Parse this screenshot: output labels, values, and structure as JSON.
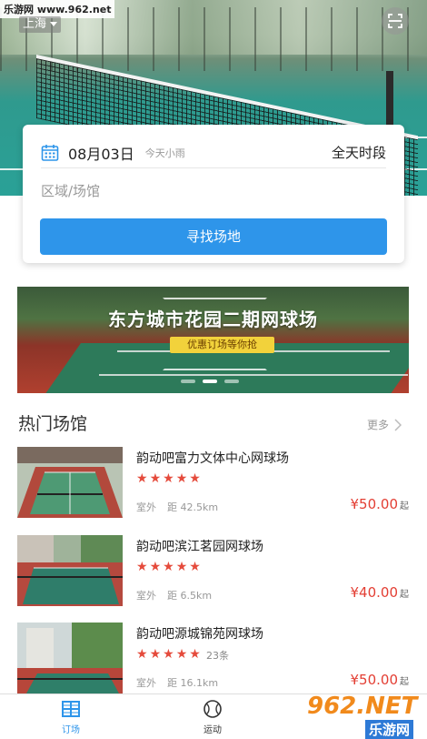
{
  "watermark": {
    "top_left": "乐游网 www.962.net",
    "bottom_right_big": "962.NET",
    "bottom_right_small": "乐游网"
  },
  "header": {
    "city": "上海"
  },
  "search": {
    "date": "08月03日",
    "weather": "今天小雨",
    "timeslot": "全天时段",
    "area_placeholder": "区域/场馆",
    "find_button": "寻找场地"
  },
  "banner": {
    "title": "东方城市花园二期网球场",
    "promo": "优惠订场等你抢",
    "dot_count": 3,
    "active_dot": 1
  },
  "section": {
    "title": "热门场馆",
    "more": "更多"
  },
  "venues": [
    {
      "name": "韵动吧富力文体中心网球场",
      "stars": 5,
      "review_count": "",
      "type": "室外",
      "distance": "距 42.5km",
      "price": "¥50.00",
      "price_suffix": "起"
    },
    {
      "name": "韵动吧滨江茗园网球场",
      "stars": 5,
      "review_count": "",
      "type": "室外",
      "distance": "距 6.5km",
      "price": "¥40.00",
      "price_suffix": "起"
    },
    {
      "name": "韵动吧源城锦苑网球场",
      "stars": 5,
      "review_count": "23条",
      "type": "室外",
      "distance": "距 16.1km",
      "price": "¥50.00",
      "price_suffix": "起"
    }
  ],
  "tabs": [
    {
      "label": "订场",
      "active": true
    },
    {
      "label": "运动",
      "active": false
    }
  ],
  "colors": {
    "accent": "#2e95ea",
    "price_red": "#e33e33",
    "star_red": "#e54b3c",
    "promo_yellow": "#f2d23b"
  }
}
